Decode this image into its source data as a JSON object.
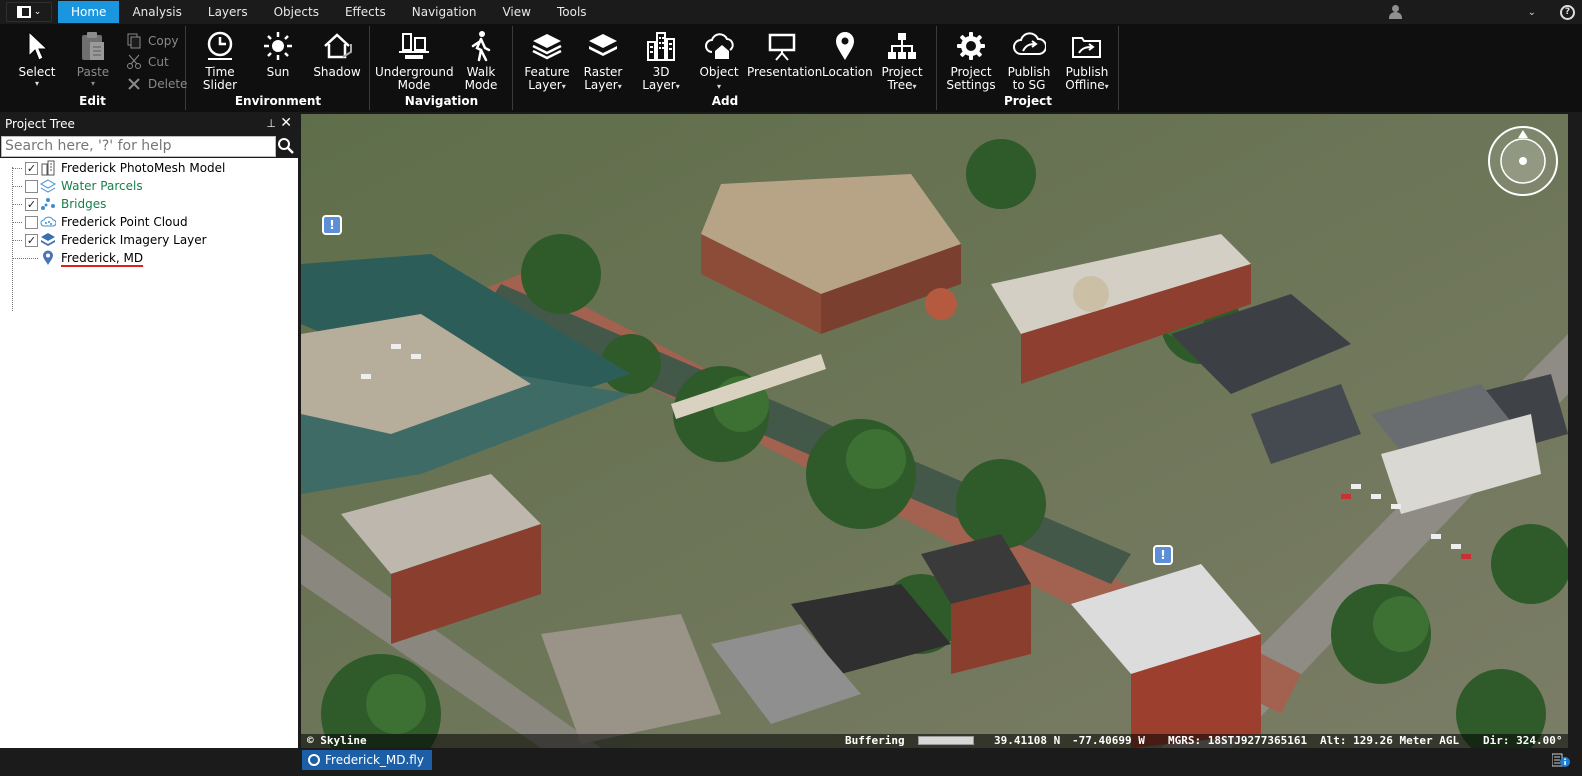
{
  "menu": {
    "tabs": [
      {
        "label": "Home",
        "active": true
      },
      {
        "label": "Analysis"
      },
      {
        "label": "Layers"
      },
      {
        "label": "Objects"
      },
      {
        "label": "Effects"
      },
      {
        "label": "Navigation"
      },
      {
        "label": "View"
      },
      {
        "label": "Tools"
      }
    ],
    "dropdown_glyph": "⌄",
    "help_glyph": "?"
  },
  "ribbon": {
    "edit": {
      "label": "Edit",
      "select": "Select",
      "paste": "Paste",
      "copy": "Copy",
      "cut": "Cut",
      "delete": "Delete"
    },
    "environment": {
      "label": "Environment",
      "time_slider": "Time\nSlider",
      "sun": "Sun",
      "shadow": "Shadow"
    },
    "navigation": {
      "label": "Navigation",
      "underground": "Underground\nMode",
      "walk": "Walk\nMode"
    },
    "add": {
      "label": "Add",
      "feature_layer": "Feature\nLayer",
      "raster_layer": "Raster\nLayer",
      "3d_layer": "3D\nLayer",
      "object": "Object",
      "presentation": "Presentation",
      "location": "Location",
      "project_tree": "Project\nTree"
    },
    "project": {
      "label": "Project",
      "settings": "Project\nSettings",
      "publish_sg": "Publish\nto SG",
      "publish_offline": "Publish\nOffline"
    },
    "dropdown_glyph": "▾"
  },
  "tree": {
    "title": "Project Tree",
    "pin_glyph": "📌",
    "close_glyph": "✕",
    "search_placeholder": "Search here, '?' for help",
    "items": [
      {
        "label": "Frederick PhotoMesh Model",
        "checked": true,
        "icon": "photomesh-icon",
        "style": "normal"
      },
      {
        "label": "Water Parcels",
        "checked": false,
        "icon": "feature-layer-icon",
        "style": "green"
      },
      {
        "label": "Bridges",
        "checked": true,
        "icon": "point-layer-icon",
        "style": "green"
      },
      {
        "label": "Frederick Point Cloud",
        "checked": false,
        "icon": "point-cloud-icon",
        "style": "normal"
      },
      {
        "label": "Frederick Imagery Layer",
        "checked": true,
        "icon": "imagery-layer-icon",
        "style": "normal"
      },
      {
        "label": "Frederick, MD",
        "checked": null,
        "icon": "location-icon",
        "style": "underline"
      }
    ]
  },
  "viewport": {
    "copyright": "© Skyline",
    "status": "Buffering",
    "lat": "39.41108 N",
    "lon": "-77.40699 W",
    "mgrs": "MGRS: 18STJ9277365161",
    "altitude": "Alt: 129.26 Meter AGL",
    "direction": "Dir: 324.00°",
    "poi_glyph": "!"
  },
  "bottom": {
    "doc_tab": "Frederick_MD.fly"
  },
  "colors": {
    "accent": "#1996dd",
    "doc_tab": "#1d5fa7",
    "green_text": "#17804a"
  }
}
